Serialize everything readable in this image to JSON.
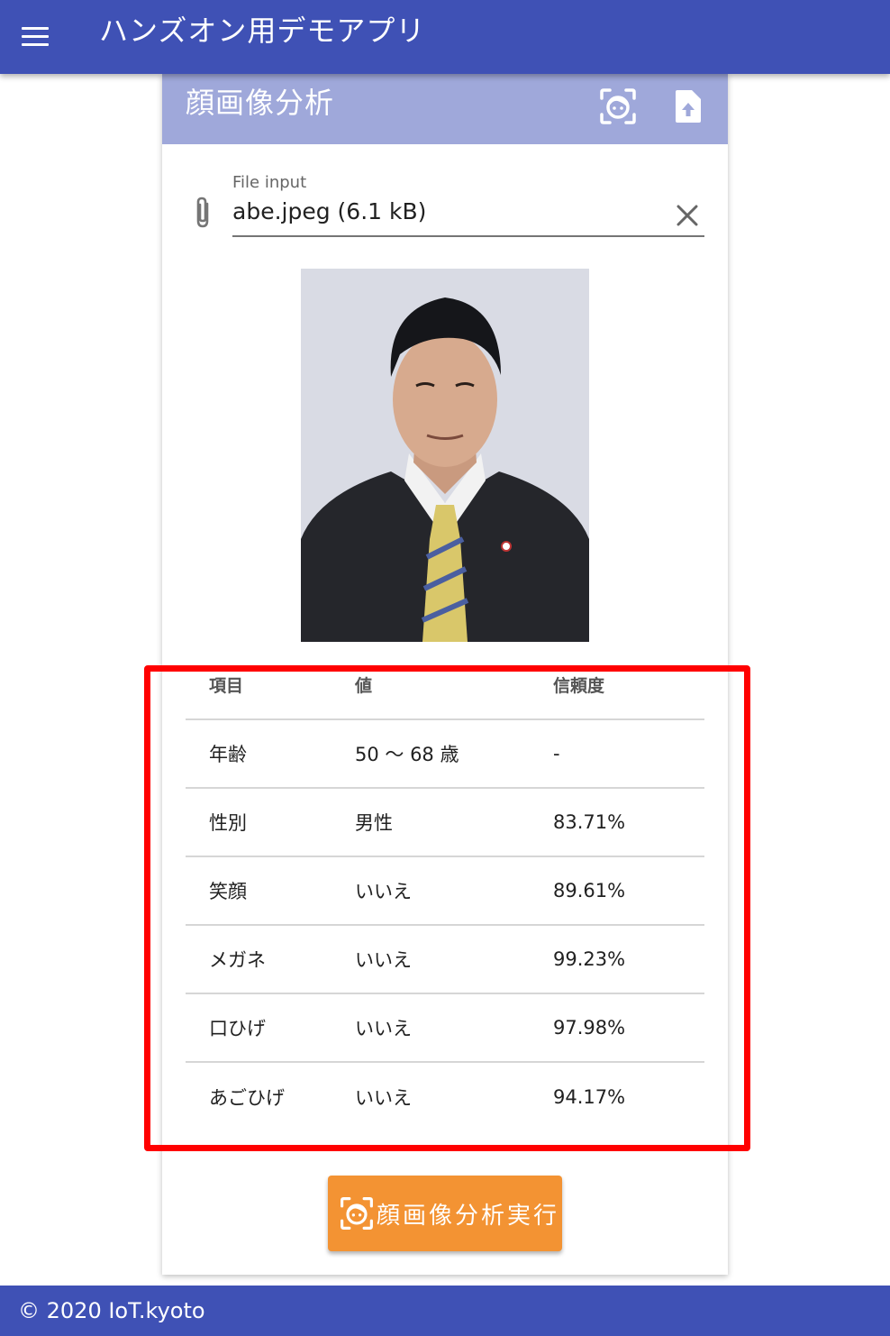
{
  "app_bar": {
    "title": "ハンズオン用デモアプリ",
    "menu_icon": "menu-icon"
  },
  "card": {
    "title": "顔画像分析",
    "icons": [
      "face-recognition-icon",
      "file-upload-icon"
    ],
    "file_input": {
      "label": "File input",
      "value": "abe.jpeg (6.1 kB)",
      "prepend_icon": "paperclip-icon",
      "clear_icon": "close-icon"
    },
    "results": {
      "headers": [
        "項目",
        "値",
        "信頼度"
      ],
      "rows": [
        {
          "item": "年齢",
          "value": "50 〜 68 歳",
          "confidence": "-"
        },
        {
          "item": "性別",
          "value": "男性",
          "confidence": "83.71%"
        },
        {
          "item": "笑顔",
          "value": "いいえ",
          "confidence": "89.61%"
        },
        {
          "item": "メガネ",
          "value": "いいえ",
          "confidence": "99.23%"
        },
        {
          "item": "口ひげ",
          "value": "いいえ",
          "confidence": "97.98%"
        },
        {
          "item": "あごひげ",
          "value": "いいえ",
          "confidence": "94.17%"
        }
      ]
    },
    "run_button": {
      "label": "顔画像分析実行",
      "icon": "face-recognition-icon"
    }
  },
  "footer": {
    "text": "© 2020 IoT.kyoto"
  },
  "colors": {
    "primary": "#3f51b5",
    "card_header": "#9fa8da",
    "accent": "#f39333",
    "highlight": "#ff0000"
  }
}
